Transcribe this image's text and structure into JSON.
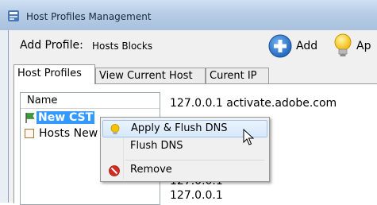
{
  "window": {
    "title": "Host Profiles Management"
  },
  "toolbar": {
    "add_profile_label": "Add Profile:",
    "profile_input_value": "Hosts Blocks",
    "add_button": "Add",
    "apply_button": "Ap"
  },
  "tabs": [
    {
      "label": "Host Profiles"
    },
    {
      "label": "View Current Host"
    },
    {
      "label": "Curent IP"
    }
  ],
  "profile_list": {
    "header": "Name",
    "items": [
      {
        "label": "New CST",
        "selected": true
      },
      {
        "label": "Hosts New",
        "selected": false
      }
    ]
  },
  "host_content": {
    "lines": [
      "127.0.0.1 activate.adobe.com",
      "127.0.0.1",
      "127.0.0.1"
    ]
  },
  "context_menu": {
    "items": [
      {
        "label": "Apply & Flush DNS",
        "icon": "lightbulb-icon"
      },
      {
        "label": "Flush DNS",
        "icon": ""
      },
      {
        "label": "Remove",
        "icon": "remove-icon"
      }
    ]
  },
  "colors": {
    "selection": "#3399ff",
    "menu_highlight": "#d6e8fb",
    "add_icon": "#2f7fd6",
    "bulb": "#f5c400",
    "remove": "#d62b1f"
  }
}
